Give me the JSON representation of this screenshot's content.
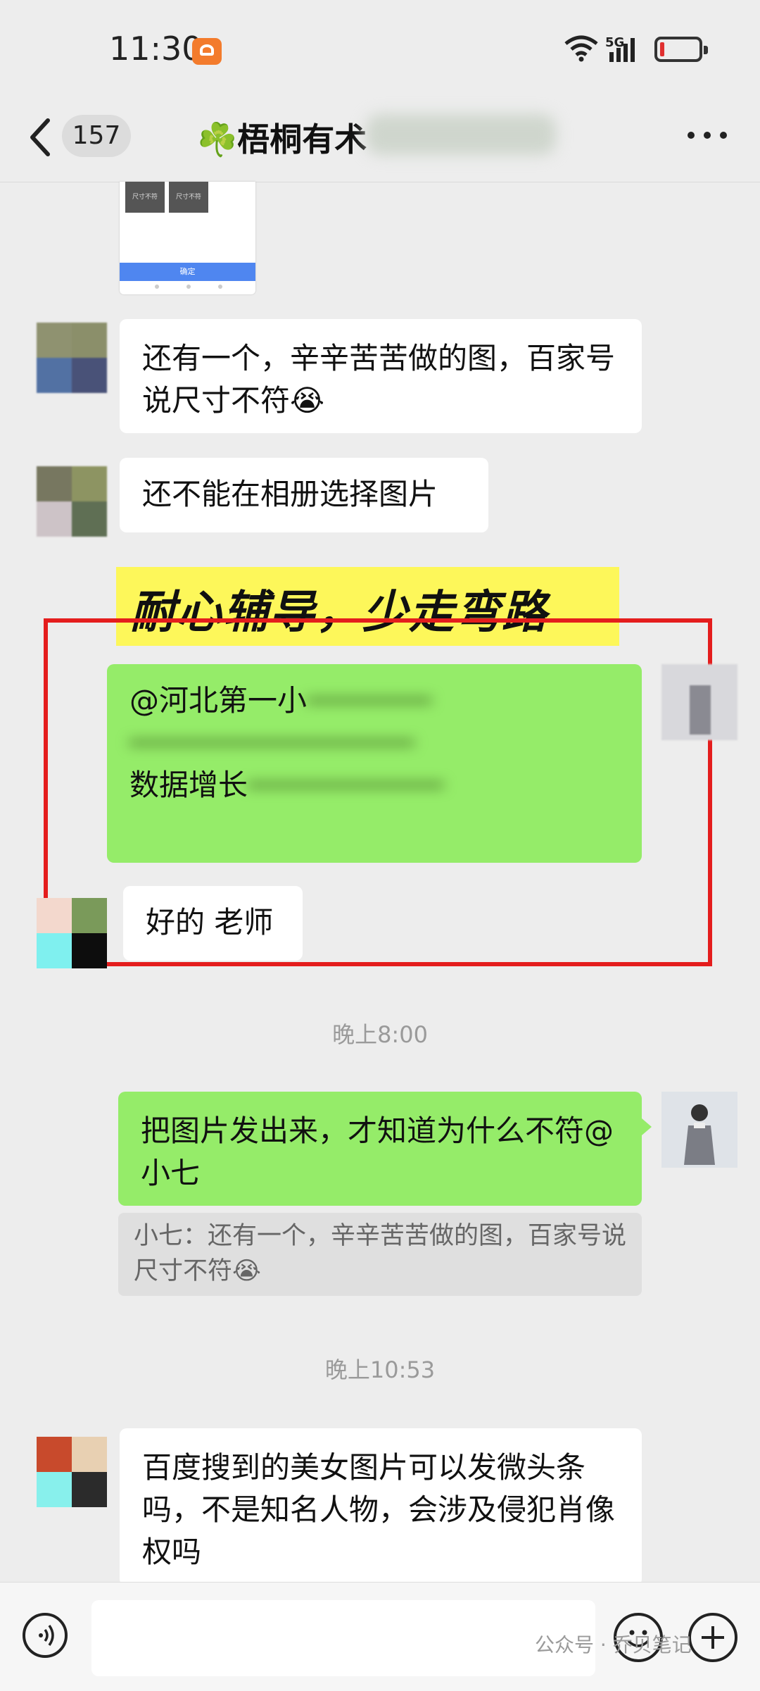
{
  "status_bar": {
    "time": "11:30",
    "network": "5G",
    "battery_color": "#e03030"
  },
  "header": {
    "unread_count": "157",
    "title": "☘️梧桐有术"
  },
  "thumbnail": {
    "button_1": "尺寸不符",
    "button_2": "尺寸不符",
    "confirm": "确定"
  },
  "annotation": {
    "text": "耐心辅导，少走弯路",
    "box_color": "#e41d1d",
    "banner_color": "#fdf75a"
  },
  "messages": [
    {
      "side": "left",
      "text": "还有一个，辛辛苦苦做的图，百家号说尺寸不符😭"
    },
    {
      "side": "left",
      "text": "还不能在相册选择图片"
    },
    {
      "side": "right",
      "lines": [
        "@河北第一小",
        "数据增长"
      ]
    },
    {
      "side": "left",
      "text": "好的 老师"
    },
    {
      "side": "right",
      "text": "把图片发出来，才知道为什么不符@小七",
      "quote": "小七：还有一个，辛辛苦苦做的图，百家号说尺寸不符😭"
    },
    {
      "side": "left",
      "text": "百度搜到的美女图片可以发微头条吗，不是知名人物，会涉及侵犯肖像权吗"
    }
  ],
  "timestamps": [
    "晚上8:00",
    "晚上10:53"
  ],
  "bottom": {
    "input_placeholder": "",
    "watermark": "公众号 · 乔贝笔记"
  },
  "colors": {
    "background": "#ededed",
    "bubble_green": "#95ec69",
    "bubble_white": "#ffffff"
  }
}
